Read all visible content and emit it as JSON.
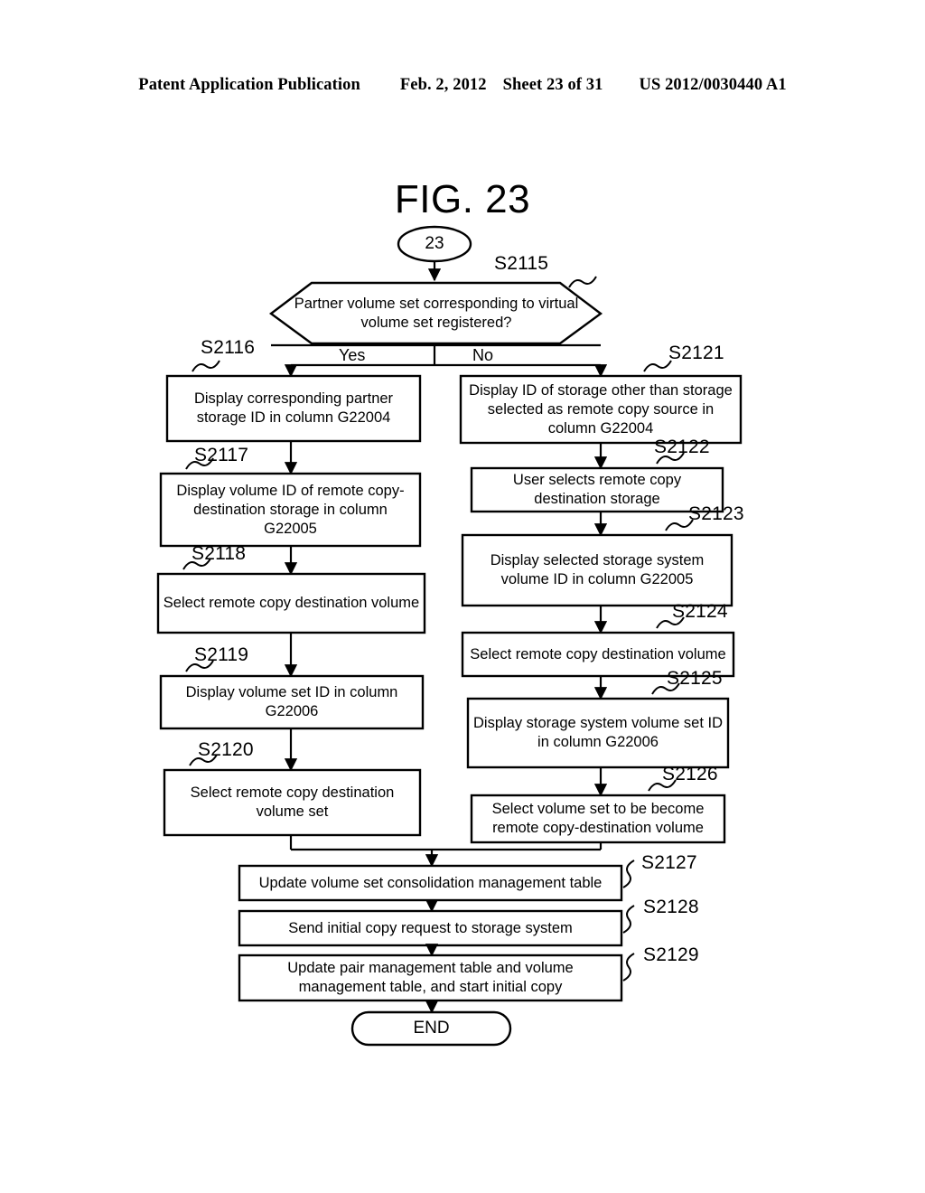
{
  "header": {
    "publication": "Patent Application Publication",
    "date": "Feb. 2, 2012",
    "sheet": "Sheet 23 of 31",
    "docnum": "US 2012/0030440 A1"
  },
  "figure": {
    "title": "FIG. 23",
    "connector_label": "23",
    "end_label": "END"
  },
  "branches": {
    "yes": "Yes",
    "no": "No"
  },
  "steps": {
    "s2115": "S2115",
    "s2116": "S2116",
    "s2117": "S2117",
    "s2118": "S2118",
    "s2119": "S2119",
    "s2120": "S2120",
    "s2121": "S2121",
    "s2122": "S2122",
    "s2123": "S2123",
    "s2124": "S2124",
    "s2125": "S2125",
    "s2126": "S2126",
    "s2127": "S2127",
    "s2128": "S2128",
    "s2129": "S2129"
  },
  "nodes": {
    "decision": "Partner volume set corresponding to virtual volume set registered?",
    "s2116_text": "Display corresponding partner storage ID in column G22004",
    "s2117_text": "Display volume ID of remote copy-destination storage in column G22005",
    "s2118_text": "Select remote copy destination volume",
    "s2119_text": "Display volume set ID in column G22006",
    "s2120_text": "Select remote copy destination volume set",
    "s2121_text": "Display ID of storage other than storage selected as remote copy source in column G22004",
    "s2122_text": "User selects remote copy destination storage",
    "s2123_text": "Display selected storage system volume ID in column G22005",
    "s2124_text": "Select remote copy destination volume",
    "s2125_text": "Display storage system volume set ID in column G22006",
    "s2126_text": "Select volume set to be become remote copy-destination volume",
    "s2127_text": "Update volume set consolidation management table",
    "s2128_text": "Send initial copy request to storage system",
    "s2129_text": "Update pair management table and volume management table, and start initial copy"
  },
  "colors": {
    "ink": "#000000",
    "paper": "#ffffff"
  }
}
